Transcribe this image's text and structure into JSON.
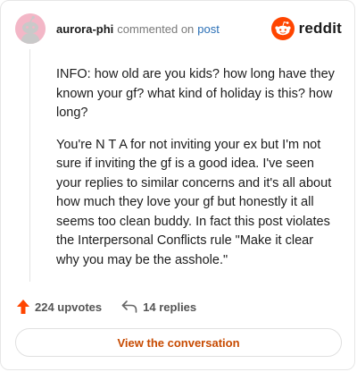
{
  "comment": {
    "username": "aurora-phi",
    "action": "commented on",
    "target_link": "post",
    "paragraphs": [
      "INFO: how old are you kids? how long have they known your gf? what kind of holiday is this? how long?",
      "You're N T A for not inviting your ex but I'm not sure if inviting the gf is a good idea. I've seen your replies to similar concerns and it's all about how much they love your gf but honestly it all seems too clean buddy. In fact this post violates the Interpersonal Conflicts rule \"Make it clear why you may be the asshole.\""
    ]
  },
  "brand": {
    "wordmark": "reddit",
    "icon": "reddit-snoo-icon",
    "color": "#ff4500"
  },
  "stats": {
    "upvotes": "224 upvotes",
    "replies": "14 replies",
    "upvote_color": "#ff4500"
  },
  "actions": {
    "view_conversation": "View the conversation"
  },
  "colors": {
    "link": "#2a6fb6",
    "cta": "#c74a00",
    "avatar_bg": "#f3b7c7"
  }
}
